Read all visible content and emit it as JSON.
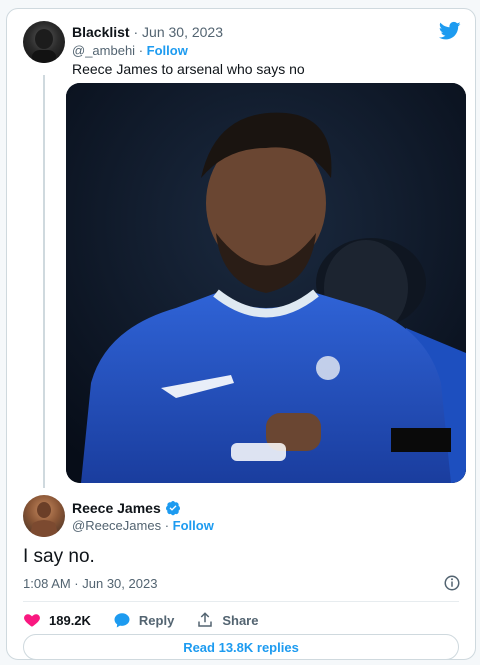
{
  "tweet": {
    "author_name": "Blacklist",
    "dot": "·",
    "date": "Jun 30, 2023",
    "handle": "@_ambehi",
    "follow": "Follow",
    "text": "Reece James to arsenal who says no"
  },
  "reply": {
    "author_name": "Reece James",
    "handle": "@ReeceJames",
    "follow": "Follow",
    "text": "I say no.",
    "timestamp": "1:08 AM · Jun 30, 2023",
    "likes": "189.2K",
    "reply_label": "Reply",
    "share_label": "Share",
    "read_replies": "Read 13.8K replies"
  },
  "colors": {
    "accent": "#1d9bf0",
    "like": "#f91880",
    "muted": "#536471"
  },
  "icons": [
    "twitter-bird-icon",
    "verified-badge-icon",
    "info-icon",
    "heart-icon",
    "reply-icon",
    "share-icon"
  ]
}
